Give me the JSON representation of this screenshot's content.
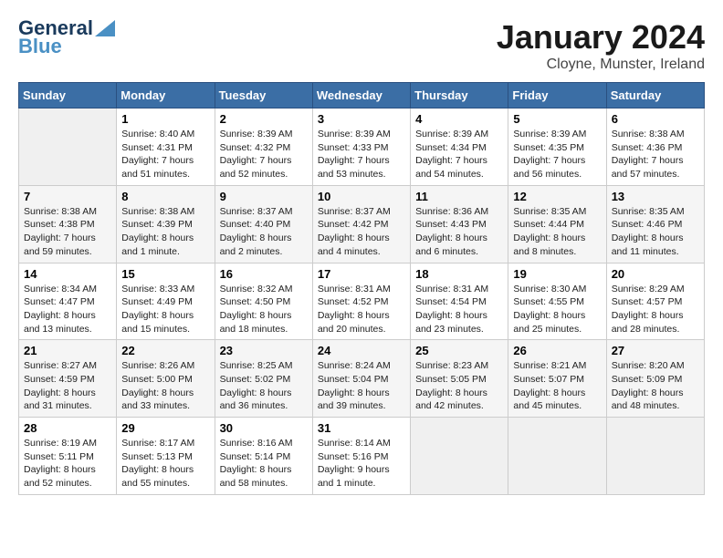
{
  "logo": {
    "line1": "General",
    "line2": "Blue"
  },
  "title": "January 2024",
  "location": "Cloyne, Munster, Ireland",
  "headers": [
    "Sunday",
    "Monday",
    "Tuesday",
    "Wednesday",
    "Thursday",
    "Friday",
    "Saturday"
  ],
  "weeks": [
    [
      {
        "day": "",
        "sunrise": "",
        "sunset": "",
        "daylight": ""
      },
      {
        "day": "1",
        "sunrise": "Sunrise: 8:40 AM",
        "sunset": "Sunset: 4:31 PM",
        "daylight": "Daylight: 7 hours and 51 minutes."
      },
      {
        "day": "2",
        "sunrise": "Sunrise: 8:39 AM",
        "sunset": "Sunset: 4:32 PM",
        "daylight": "Daylight: 7 hours and 52 minutes."
      },
      {
        "day": "3",
        "sunrise": "Sunrise: 8:39 AM",
        "sunset": "Sunset: 4:33 PM",
        "daylight": "Daylight: 7 hours and 53 minutes."
      },
      {
        "day": "4",
        "sunrise": "Sunrise: 8:39 AM",
        "sunset": "Sunset: 4:34 PM",
        "daylight": "Daylight: 7 hours and 54 minutes."
      },
      {
        "day": "5",
        "sunrise": "Sunrise: 8:39 AM",
        "sunset": "Sunset: 4:35 PM",
        "daylight": "Daylight: 7 hours and 56 minutes."
      },
      {
        "day": "6",
        "sunrise": "Sunrise: 8:38 AM",
        "sunset": "Sunset: 4:36 PM",
        "daylight": "Daylight: 7 hours and 57 minutes."
      }
    ],
    [
      {
        "day": "7",
        "sunrise": "Sunrise: 8:38 AM",
        "sunset": "Sunset: 4:38 PM",
        "daylight": "Daylight: 7 hours and 59 minutes."
      },
      {
        "day": "8",
        "sunrise": "Sunrise: 8:38 AM",
        "sunset": "Sunset: 4:39 PM",
        "daylight": "Daylight: 8 hours and 1 minute."
      },
      {
        "day": "9",
        "sunrise": "Sunrise: 8:37 AM",
        "sunset": "Sunset: 4:40 PM",
        "daylight": "Daylight: 8 hours and 2 minutes."
      },
      {
        "day": "10",
        "sunrise": "Sunrise: 8:37 AM",
        "sunset": "Sunset: 4:42 PM",
        "daylight": "Daylight: 8 hours and 4 minutes."
      },
      {
        "day": "11",
        "sunrise": "Sunrise: 8:36 AM",
        "sunset": "Sunset: 4:43 PM",
        "daylight": "Daylight: 8 hours and 6 minutes."
      },
      {
        "day": "12",
        "sunrise": "Sunrise: 8:35 AM",
        "sunset": "Sunset: 4:44 PM",
        "daylight": "Daylight: 8 hours and 8 minutes."
      },
      {
        "day": "13",
        "sunrise": "Sunrise: 8:35 AM",
        "sunset": "Sunset: 4:46 PM",
        "daylight": "Daylight: 8 hours and 11 minutes."
      }
    ],
    [
      {
        "day": "14",
        "sunrise": "Sunrise: 8:34 AM",
        "sunset": "Sunset: 4:47 PM",
        "daylight": "Daylight: 8 hours and 13 minutes."
      },
      {
        "day": "15",
        "sunrise": "Sunrise: 8:33 AM",
        "sunset": "Sunset: 4:49 PM",
        "daylight": "Daylight: 8 hours and 15 minutes."
      },
      {
        "day": "16",
        "sunrise": "Sunrise: 8:32 AM",
        "sunset": "Sunset: 4:50 PM",
        "daylight": "Daylight: 8 hours and 18 minutes."
      },
      {
        "day": "17",
        "sunrise": "Sunrise: 8:31 AM",
        "sunset": "Sunset: 4:52 PM",
        "daylight": "Daylight: 8 hours and 20 minutes."
      },
      {
        "day": "18",
        "sunrise": "Sunrise: 8:31 AM",
        "sunset": "Sunset: 4:54 PM",
        "daylight": "Daylight: 8 hours and 23 minutes."
      },
      {
        "day": "19",
        "sunrise": "Sunrise: 8:30 AM",
        "sunset": "Sunset: 4:55 PM",
        "daylight": "Daylight: 8 hours and 25 minutes."
      },
      {
        "day": "20",
        "sunrise": "Sunrise: 8:29 AM",
        "sunset": "Sunset: 4:57 PM",
        "daylight": "Daylight: 8 hours and 28 minutes."
      }
    ],
    [
      {
        "day": "21",
        "sunrise": "Sunrise: 8:27 AM",
        "sunset": "Sunset: 4:59 PM",
        "daylight": "Daylight: 8 hours and 31 minutes."
      },
      {
        "day": "22",
        "sunrise": "Sunrise: 8:26 AM",
        "sunset": "Sunset: 5:00 PM",
        "daylight": "Daylight: 8 hours and 33 minutes."
      },
      {
        "day": "23",
        "sunrise": "Sunrise: 8:25 AM",
        "sunset": "Sunset: 5:02 PM",
        "daylight": "Daylight: 8 hours and 36 minutes."
      },
      {
        "day": "24",
        "sunrise": "Sunrise: 8:24 AM",
        "sunset": "Sunset: 5:04 PM",
        "daylight": "Daylight: 8 hours and 39 minutes."
      },
      {
        "day": "25",
        "sunrise": "Sunrise: 8:23 AM",
        "sunset": "Sunset: 5:05 PM",
        "daylight": "Daylight: 8 hours and 42 minutes."
      },
      {
        "day": "26",
        "sunrise": "Sunrise: 8:21 AM",
        "sunset": "Sunset: 5:07 PM",
        "daylight": "Daylight: 8 hours and 45 minutes."
      },
      {
        "day": "27",
        "sunrise": "Sunrise: 8:20 AM",
        "sunset": "Sunset: 5:09 PM",
        "daylight": "Daylight: 8 hours and 48 minutes."
      }
    ],
    [
      {
        "day": "28",
        "sunrise": "Sunrise: 8:19 AM",
        "sunset": "Sunset: 5:11 PM",
        "daylight": "Daylight: 8 hours and 52 minutes."
      },
      {
        "day": "29",
        "sunrise": "Sunrise: 8:17 AM",
        "sunset": "Sunset: 5:13 PM",
        "daylight": "Daylight: 8 hours and 55 minutes."
      },
      {
        "day": "30",
        "sunrise": "Sunrise: 8:16 AM",
        "sunset": "Sunset: 5:14 PM",
        "daylight": "Daylight: 8 hours and 58 minutes."
      },
      {
        "day": "31",
        "sunrise": "Sunrise: 8:14 AM",
        "sunset": "Sunset: 5:16 PM",
        "daylight": "Daylight: 9 hours and 1 minute."
      },
      {
        "day": "",
        "sunrise": "",
        "sunset": "",
        "daylight": ""
      },
      {
        "day": "",
        "sunrise": "",
        "sunset": "",
        "daylight": ""
      },
      {
        "day": "",
        "sunrise": "",
        "sunset": "",
        "daylight": ""
      }
    ]
  ]
}
